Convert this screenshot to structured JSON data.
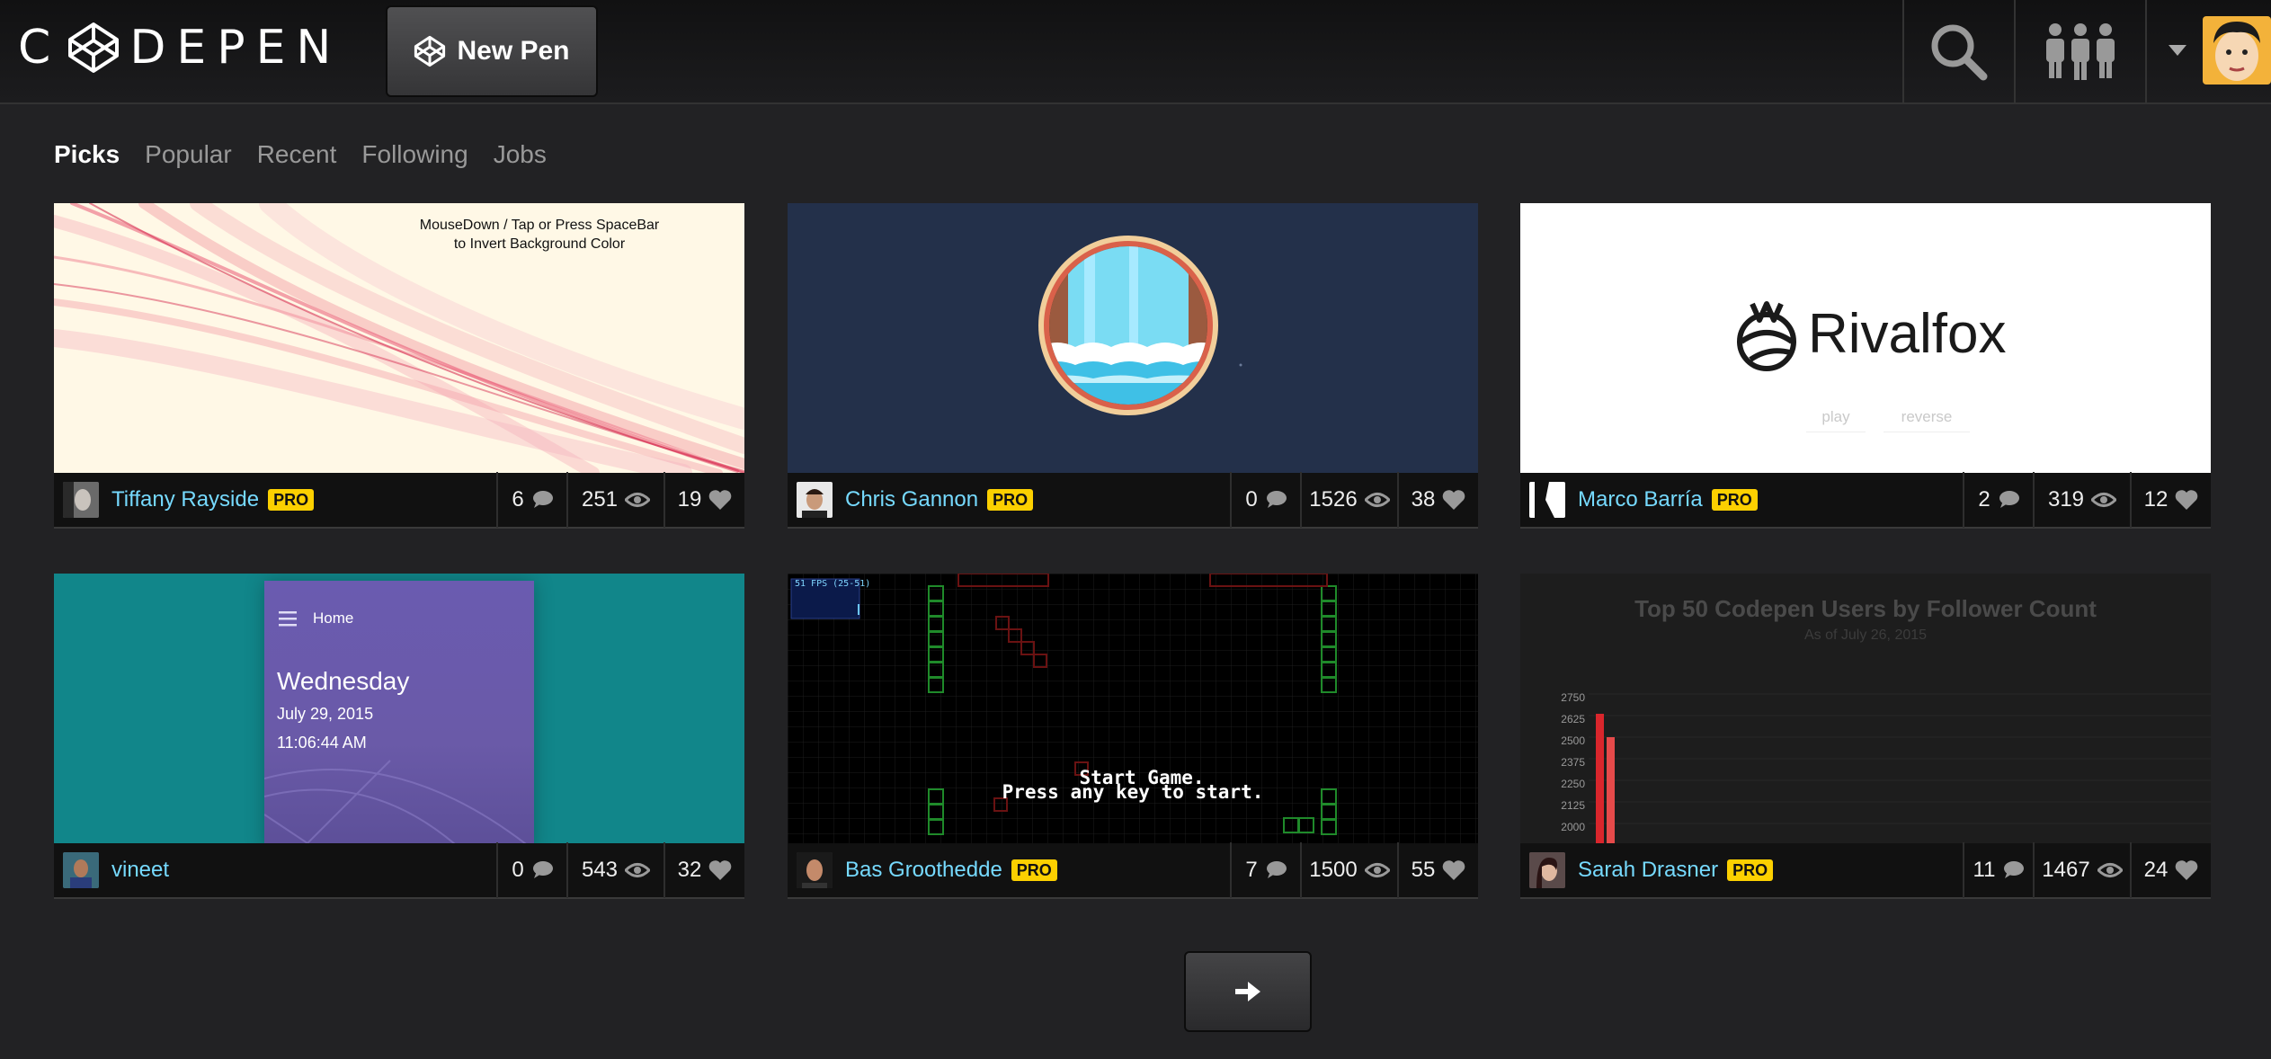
{
  "header": {
    "logo_text": "CODEPEN",
    "new_pen_label": "New Pen"
  },
  "tabs": [
    "Picks",
    "Popular",
    "Recent",
    "Following",
    "Jobs"
  ],
  "active_tab": "Picks",
  "cards": [
    {
      "author": "Tiffany Rayside",
      "pro": "PRO",
      "comments": "6",
      "views": "251",
      "hearts": "19",
      "preview_text_1": "MouseDown / Tap or Press SpaceBar",
      "preview_text_2": "to Invert Background Color"
    },
    {
      "author": "Chris Gannon",
      "pro": "PRO",
      "comments": "0",
      "views": "1526",
      "hearts": "38"
    },
    {
      "author": "Marco Barría",
      "pro": "PRO",
      "comments": "2",
      "views": "319",
      "hearts": "12",
      "preview_brand": "Rivalfox",
      "preview_play": "play",
      "preview_reverse": "reverse"
    },
    {
      "author": "vineet",
      "comments": "0",
      "views": "543",
      "hearts": "32",
      "preview_home": "Home",
      "preview_day": "Wednesday",
      "preview_date": "July 29, 2015",
      "preview_time": "11:06:44 AM"
    },
    {
      "author": "Bas Groothedde",
      "pro": "PRO",
      "comments": "7",
      "views": "1500",
      "hearts": "55",
      "preview_fps": "51 FPS (25-51)",
      "preview_line1": "Start Game.",
      "preview_line2": "Press any key to start."
    },
    {
      "author": "Sarah Drasner",
      "pro": "PRO",
      "comments": "11",
      "views": "1467",
      "hearts": "24",
      "preview_title": "Top 50 Codepen Users by Follower Count",
      "preview_subtitle": "As of July 26, 2015",
      "preview_ticks": [
        "2750",
        "2625",
        "2500",
        "2375",
        "2250",
        "2125",
        "2000"
      ]
    }
  ],
  "colors": {
    "accent_link": "#76daff",
    "pro_badge": "#fcd000",
    "background": "#222224"
  }
}
